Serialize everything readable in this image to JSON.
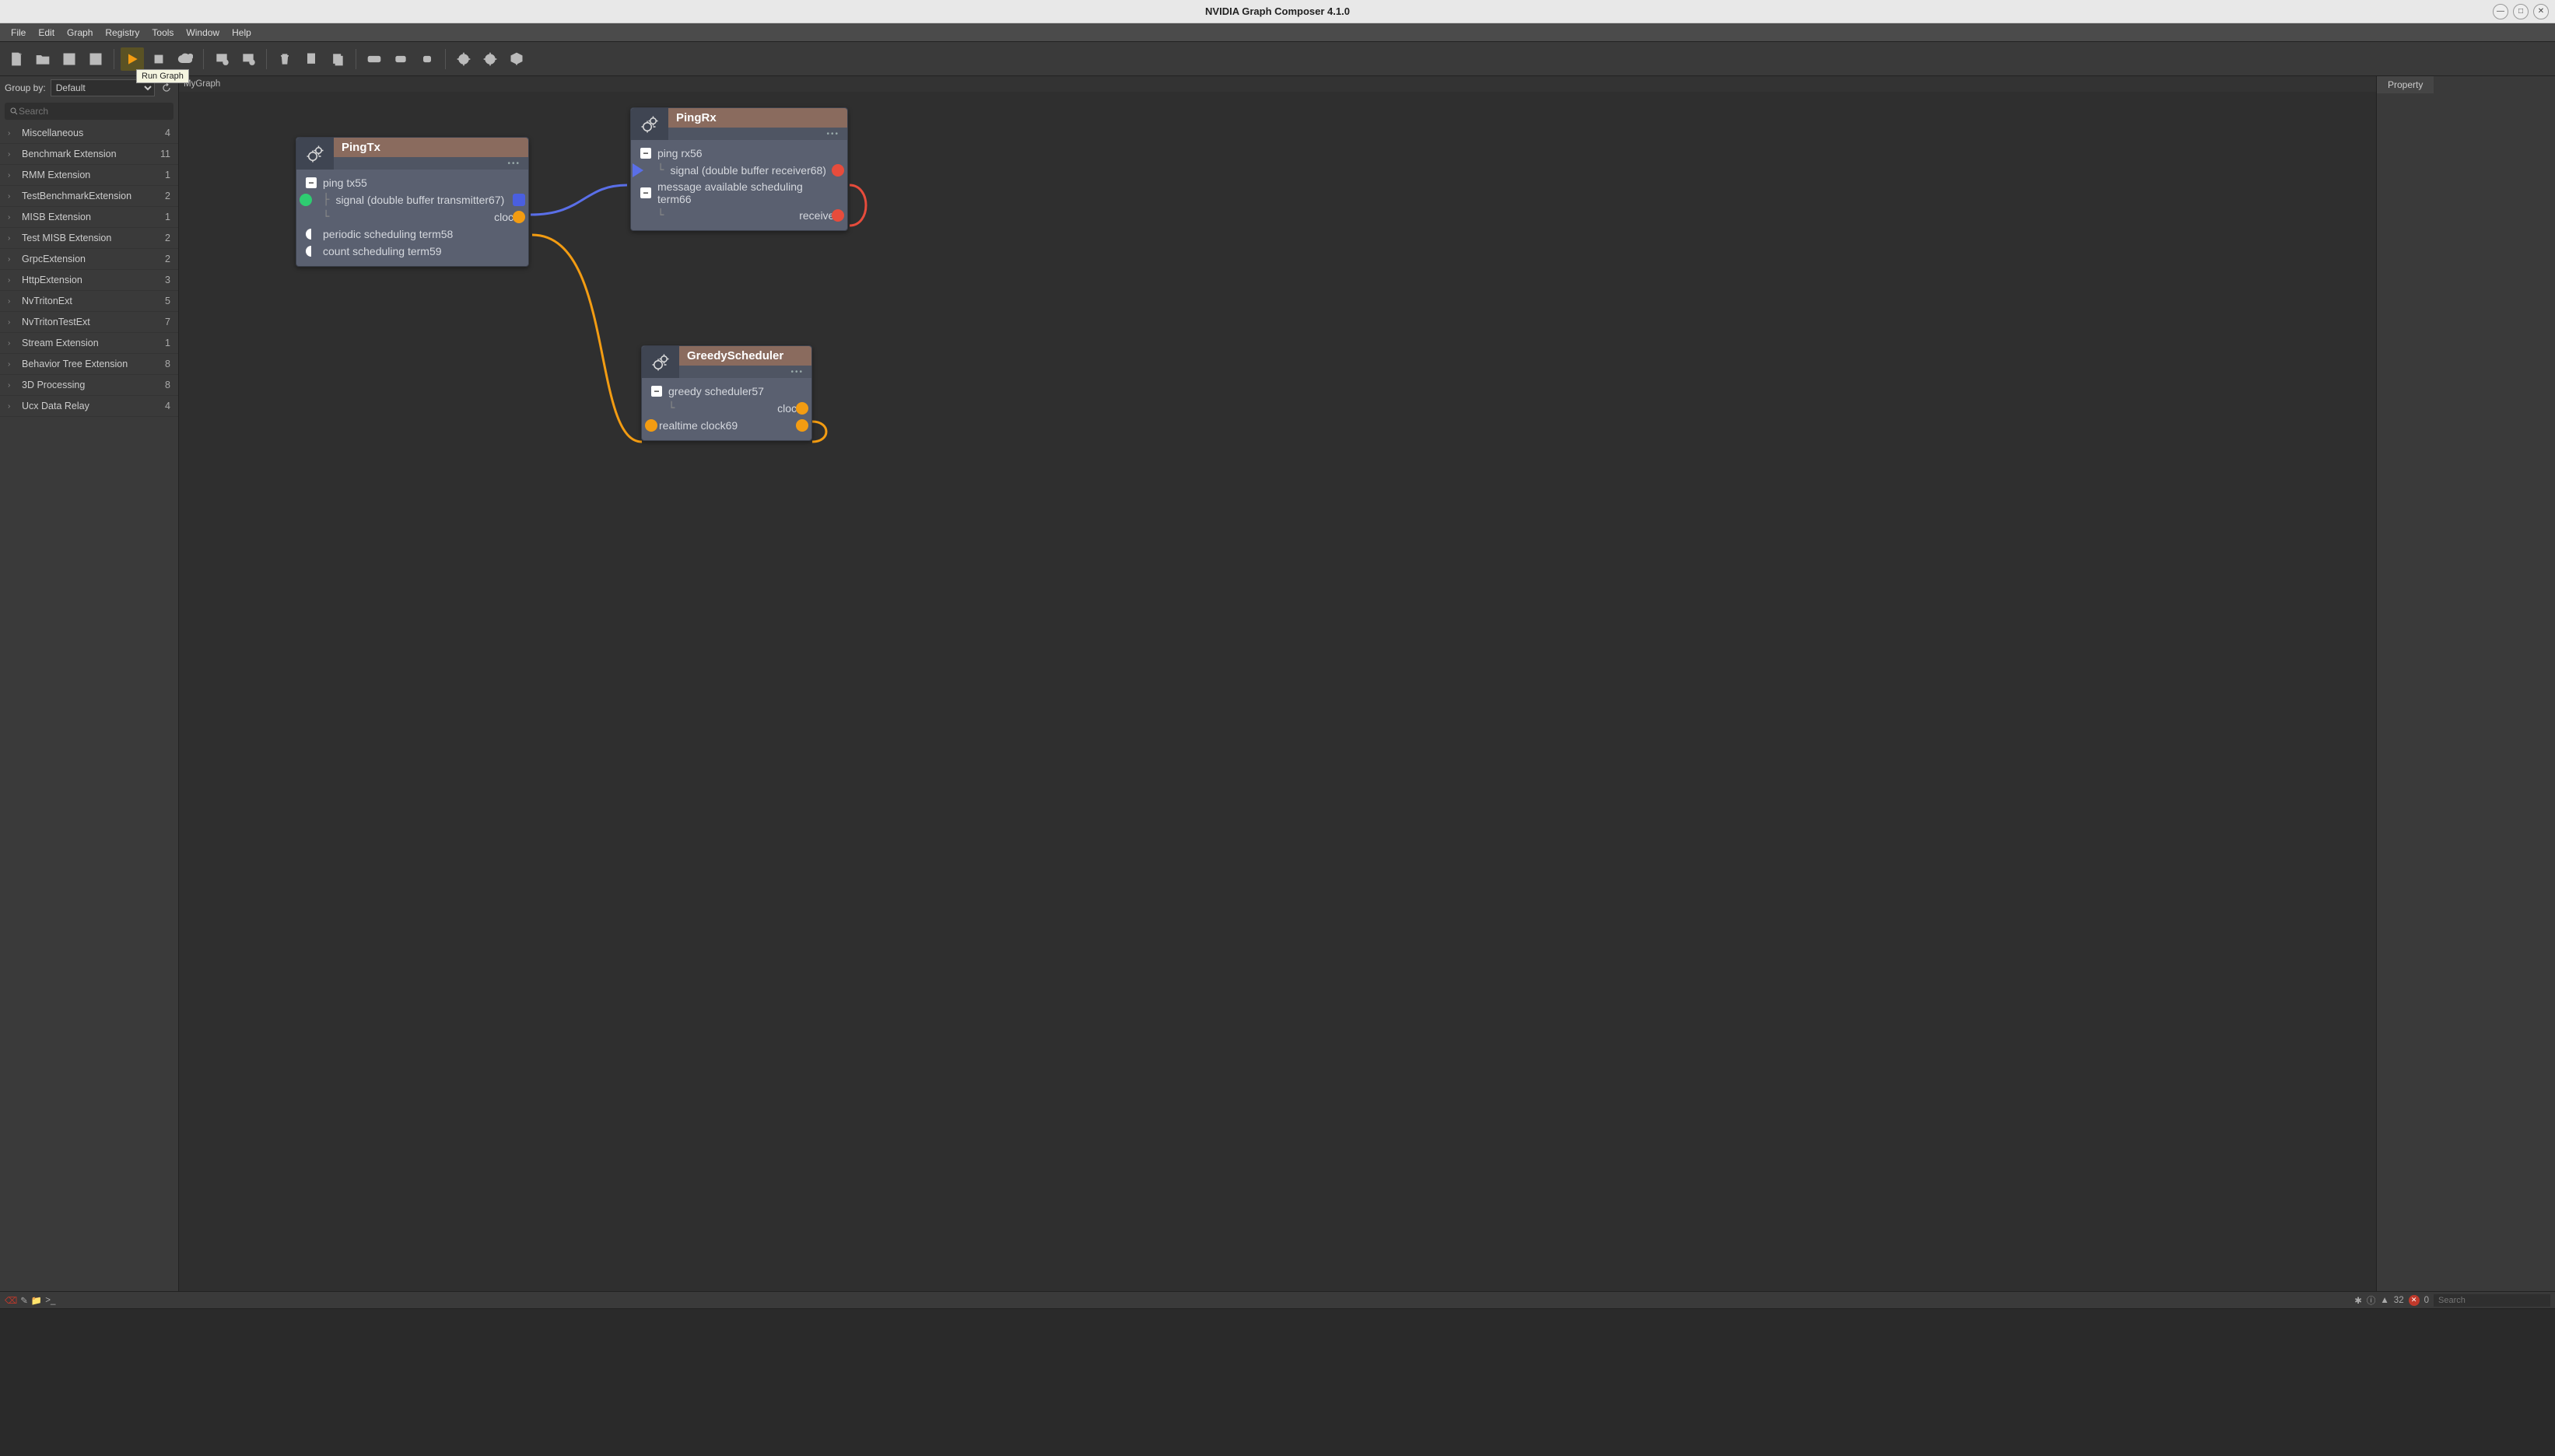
{
  "titlebar": {
    "title": "NVIDIA Graph Composer 4.1.0"
  },
  "menu": [
    "File",
    "Edit",
    "Graph",
    "Registry",
    "Tools",
    "Window",
    "Help"
  ],
  "toolbar": {
    "run_tooltip": "Run Graph"
  },
  "sidebar": {
    "groupby_label": "Group by:",
    "groupby_value": "Default",
    "search_placeholder": "Search",
    "items": [
      {
        "name": "Miscellaneous",
        "count": 4
      },
      {
        "name": "Benchmark Extension",
        "count": 11
      },
      {
        "name": "RMM Extension",
        "count": 1
      },
      {
        "name": "TestBenchmarkExtension",
        "count": 2
      },
      {
        "name": "MISB Extension",
        "count": 1
      },
      {
        "name": "Test MISB Extension",
        "count": 2
      },
      {
        "name": "GrpcExtension",
        "count": 2
      },
      {
        "name": "HttpExtension",
        "count": 3
      },
      {
        "name": "NvTritonExt",
        "count": 5
      },
      {
        "name": "NvTritonTestExt",
        "count": 7
      },
      {
        "name": "Stream Extension",
        "count": 1
      },
      {
        "name": "Behavior Tree Extension",
        "count": 8
      },
      {
        "name": "3D Processing",
        "count": 8
      },
      {
        "name": "Ucx Data Relay",
        "count": 4
      }
    ]
  },
  "canvas": {
    "tab": "MyGraph",
    "nodes": {
      "pingtx": {
        "title": "PingTx",
        "rows": {
          "r0": "ping tx55",
          "r1": "signal (double buffer transmitter67)",
          "r2": "clock",
          "r3": "periodic scheduling term58",
          "r4": "count scheduling term59"
        }
      },
      "pingrx": {
        "title": "PingRx",
        "rows": {
          "r0": "ping rx56",
          "r1": "signal (double buffer receiver68)",
          "r2": "message available scheduling term66",
          "r3": "receiver"
        }
      },
      "greedy": {
        "title": "GreedyScheduler",
        "rows": {
          "r0": "greedy scheduler57",
          "r1": "clock",
          "r2": "realtime clock69"
        }
      }
    }
  },
  "rightpanel": {
    "tab": "Property"
  },
  "statusbar": {
    "warn_count": "32",
    "err_count": "0",
    "search_placeholder": "Search"
  }
}
